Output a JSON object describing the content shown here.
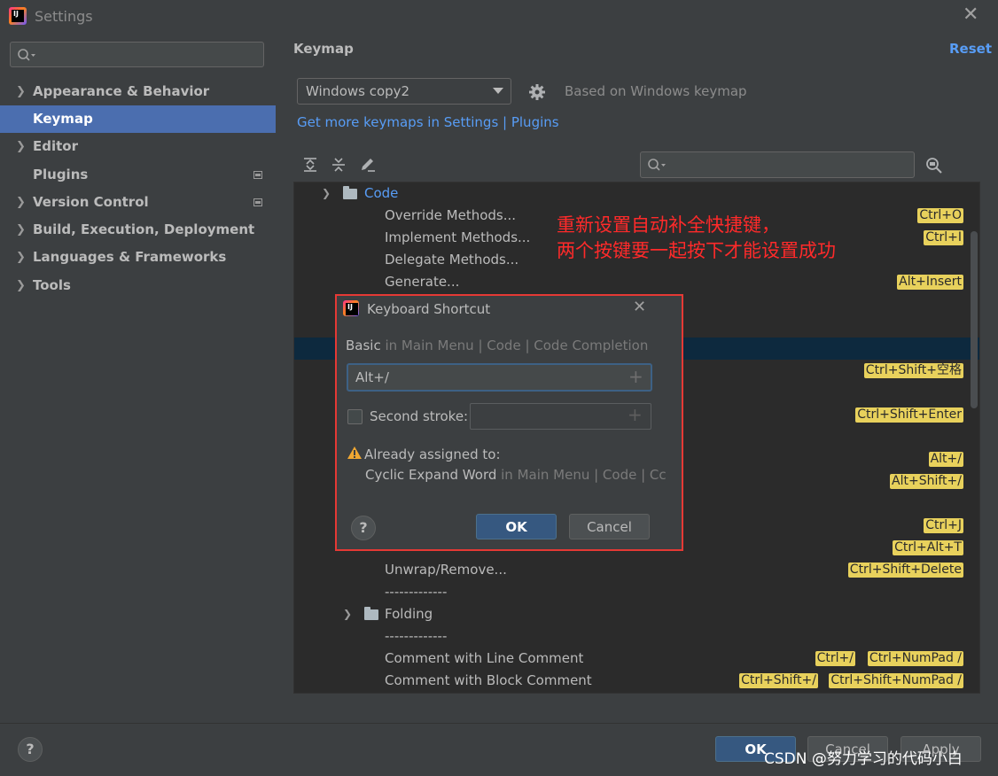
{
  "window": {
    "title": "Settings",
    "app_icon_label": "IJ"
  },
  "sidebar": {
    "items": [
      {
        "label": "Appearance & Behavior",
        "expandable": true
      },
      {
        "label": "Keymap",
        "selected": true
      },
      {
        "label": "Editor",
        "expandable": true
      },
      {
        "label": "Plugins",
        "has_icon": true
      },
      {
        "label": "Version Control",
        "expandable": true,
        "has_icon": true
      },
      {
        "label": "Build, Execution, Deployment",
        "expandable": true
      },
      {
        "label": "Languages & Frameworks",
        "expandable": true
      },
      {
        "label": "Tools",
        "expandable": true
      }
    ]
  },
  "header": {
    "title": "Keymap",
    "reset": "Reset"
  },
  "keymap": {
    "selected": "Windows copy2",
    "based_on": "Based on Windows keymap",
    "get_more": "Get more keymaps in Settings | Plugins"
  },
  "tree": {
    "group": "Code",
    "rows": [
      {
        "label": "Override Methods...",
        "keys": [
          "Ctrl+O"
        ]
      },
      {
        "label": "Implement Methods...",
        "keys": [
          "Ctrl+I"
        ]
      },
      {
        "label": "Delegate Methods...",
        "keys": []
      },
      {
        "label": "Generate...",
        "keys": [
          "Alt+Insert"
        ]
      },
      {
        "label": "",
        "keys": []
      },
      {
        "label": "",
        "keys": []
      },
      {
        "label": "",
        "keys": [
          "Ctrl+Shift+空格"
        ]
      },
      {
        "label": "",
        "keys": []
      },
      {
        "label": "",
        "keys": [
          "Ctrl+Shift+Enter"
        ]
      },
      {
        "label": "",
        "keys": []
      },
      {
        "label": "",
        "keys": [
          "Alt+/"
        ]
      },
      {
        "label": "",
        "keys": [
          "Alt+Shift+/"
        ]
      },
      {
        "label": "",
        "keys": []
      },
      {
        "label": "",
        "keys": [
          "Ctrl+J"
        ]
      },
      {
        "label": "",
        "keys": [
          "Ctrl+Alt+T"
        ]
      },
      {
        "label": "Unwrap/Remove...",
        "keys": [
          "Ctrl+Shift+Delete"
        ]
      },
      {
        "label": "-------------",
        "keys": []
      },
      {
        "label": "Folding",
        "keys": [],
        "folder": true
      },
      {
        "label": "-------------",
        "keys": []
      },
      {
        "label": "Comment with Line Comment",
        "keys": [
          "Ctrl+/",
          "Ctrl+NumPad /"
        ]
      },
      {
        "label": "Comment with Block Comment",
        "keys": [
          "Ctrl+Shift+/",
          "Ctrl+Shift+NumPad /"
        ]
      }
    ]
  },
  "dialog": {
    "title": "Keyboard Shortcut",
    "path_action": "Basic",
    "path_rest": " in Main Menu | Code | Code Completion",
    "shortcut_value": "Alt+/",
    "second_stroke_label": "Second stroke:",
    "warning_title": "Already assigned to:",
    "conflict_action": "Cyclic Expand Word",
    "conflict_path": " in Main Menu | Code | Cc",
    "ok": "OK",
    "cancel": "Cancel",
    "help": "?"
  },
  "annotation": {
    "line1": "重新设置自动补全快捷键，",
    "line2": "两个按键要一起按下才能设置成功"
  },
  "footer": {
    "help": "?",
    "ok": "OK",
    "cancel": "Cancel",
    "apply": "Apply"
  },
  "watermark": "CSDN @努力学习的代码小白"
}
